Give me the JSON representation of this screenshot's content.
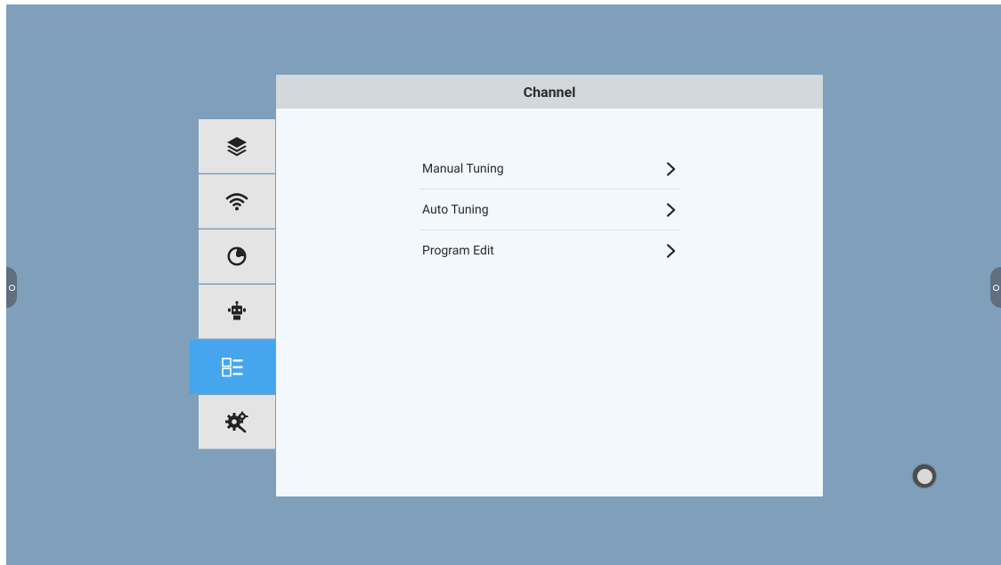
{
  "panel": {
    "title": "Channel"
  },
  "menu": {
    "items": [
      {
        "label": "Manual Tuning",
        "icon": "chevron-right-icon"
      },
      {
        "label": "Auto Tuning",
        "icon": "chevron-right-icon"
      },
      {
        "label": "Program Edit",
        "icon": "chevron-right-icon"
      }
    ]
  },
  "sidebar": {
    "tabs": [
      {
        "icon": "layers-icon",
        "active": false
      },
      {
        "icon": "wifi-icon",
        "active": false
      },
      {
        "icon": "clock-icon",
        "active": false
      },
      {
        "icon": "robot-icon",
        "active": false
      },
      {
        "icon": "channel-list-icon",
        "active": true
      },
      {
        "icon": "settings-gears-icon",
        "active": false
      }
    ]
  },
  "colors": {
    "background": "#7f9fbb",
    "active_tab": "#45a6ee",
    "tab": "#e4e4e4",
    "panel": "#f3f8fc",
    "header": "#d3d8dc"
  }
}
